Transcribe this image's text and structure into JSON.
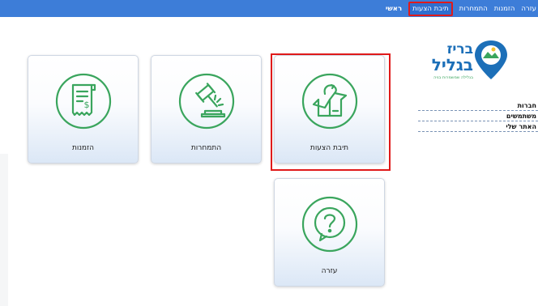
{
  "topnav": {
    "items": [
      {
        "label": "ראשי"
      },
      {
        "label": "תיבת הצעות"
      },
      {
        "label": "התמחרות"
      },
      {
        "label": "הזמנות"
      },
      {
        "label": "עזרה"
      }
    ]
  },
  "logo": {
    "line1": "בריז",
    "line2": "בגליל",
    "tagline": "בגלילה שמשמרות בניה"
  },
  "sidemenu": {
    "items": [
      {
        "label": "חברות"
      },
      {
        "label": "משתמשים"
      },
      {
        "label": "האתר שלי"
      }
    ]
  },
  "tiles": [
    {
      "label": "הזמנות",
      "icon": "receipt-icon"
    },
    {
      "label": "התמחרות",
      "icon": "gavel-icon"
    },
    {
      "label": "תיבת הצעות",
      "icon": "suggestion-box-icon"
    },
    {
      "label": "עזרה",
      "icon": "question-mark-icon"
    }
  ],
  "colors": {
    "topbar": "#3d7dd8",
    "icon_green": "#3aa55d",
    "highlight_red": "#e01a1a"
  }
}
